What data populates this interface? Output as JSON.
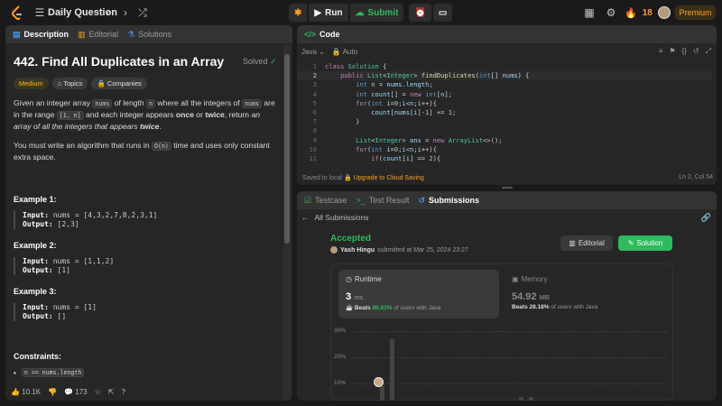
{
  "header": {
    "title": "Daily Question",
    "run_label": "Run",
    "submit_label": "Submit",
    "streak": "18",
    "premium_label": "Premium"
  },
  "left_panel": {
    "tabs": [
      "Description",
      "Editorial",
      "Solutions"
    ],
    "problem_title": "442. Find All Duplicates in an Array",
    "solved_label": "Solved",
    "tags": [
      "Medium",
      "Topics",
      "Companies"
    ],
    "desc": {
      "p1_a": "Given an integer array ",
      "p1_code1": "nums",
      "p1_b": " of length ",
      "p1_code2": "n",
      "p1_c": " where all the integers of ",
      "p1_code3": "nums",
      "p1_d": " are in the range ",
      "p1_code4": "[1, n]",
      "p1_e": " and each integer appears ",
      "p1_once": "once",
      "p1_f": " or ",
      "p1_twice": "twice",
      "p1_g": ", return ",
      "p1_it": "an array of all the integers that appears ",
      "p1_twice2": "twice",
      "p1_end": ".",
      "p2_a": "You must write an algorithm that runs in ",
      "p2_code": "O(n)",
      "p2_b": " time and uses only constant extra space."
    },
    "examples": [
      {
        "title": "Example 1:",
        "input_label": "Input:",
        "input": "nums = [4,3,2,7,8,2,3,1]",
        "output_label": "Output:",
        "output": "[2,3]"
      },
      {
        "title": "Example 2:",
        "input_label": "Input:",
        "input": "nums = [1,1,2]",
        "output_label": "Output:",
        "output": "[1]"
      },
      {
        "title": "Example 3:",
        "input_label": "Input:",
        "input": "nums = [1]",
        "output_label": "Output:",
        "output": "[]"
      }
    ],
    "constraints_title": "Constraints:",
    "constraint1": "n == nums.length",
    "footer": {
      "likes": "10.1K",
      "comments": "173"
    }
  },
  "code_panel": {
    "tab_label": "Code",
    "language": "Java",
    "mode": "Auto",
    "lines": [
      {
        "n": "1"
      },
      {
        "n": "2"
      },
      {
        "n": "3"
      },
      {
        "n": "4"
      },
      {
        "n": "5"
      },
      {
        "n": "6"
      },
      {
        "n": "7"
      },
      {
        "n": "8"
      },
      {
        "n": "9"
      },
      {
        "n": "10"
      },
      {
        "n": "11"
      }
    ],
    "saved_label": "Saved to local",
    "upgrade_label": "Upgrade to Cloud Saving",
    "cursor_pos": "Ln 2, Col 54"
  },
  "result_panel": {
    "tabs": [
      "Testcase",
      "Test Result",
      "Submissions"
    ],
    "back_label": "All Submissions",
    "status": "Accepted",
    "user": "Yash Hingu",
    "submitted_text": "submitted at Mar 25, 2024 23:27",
    "editorial_label": "Editorial",
    "solution_label": "Solution",
    "runtime": {
      "title": "Runtime",
      "value": "3",
      "unit": "ms",
      "beats_label": "Beats",
      "beats": "99.83%",
      "suffix": "of users with Java"
    },
    "memory": {
      "title": "Memory",
      "value": "54.92",
      "unit": "MB",
      "beats_label": "Beats",
      "beats": "28.18%",
      "suffix": "of users with Java"
    },
    "chart_labels": [
      "30%",
      "20%",
      "10%"
    ]
  },
  "chart_data": {
    "type": "bar",
    "ylabel": "",
    "ylim": [
      0,
      32
    ],
    "yticks": [
      "30%",
      "20%",
      "10%"
    ],
    "values": [
      3,
      9,
      27,
      0,
      0,
      0,
      0,
      0,
      0,
      0,
      0,
      0,
      0,
      0,
      0,
      5,
      5
    ]
  }
}
